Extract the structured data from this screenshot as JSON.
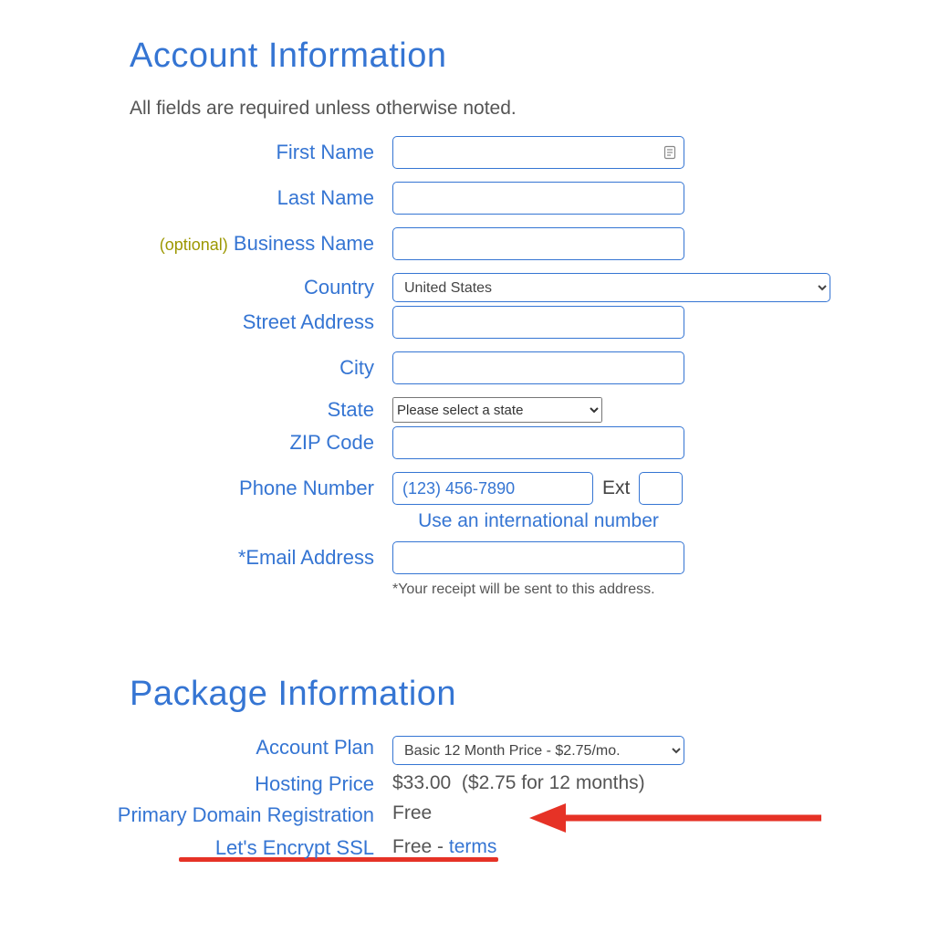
{
  "account": {
    "title": "Account Information",
    "instructions": "All fields are required unless otherwise noted.",
    "labels": {
      "first_name": "First Name",
      "last_name": "Last Name",
      "business_name": "Business Name",
      "business_optional": "(optional)",
      "country": "Country",
      "street_address": "Street Address",
      "city": "City",
      "state": "State",
      "zip": "ZIP Code",
      "phone": "Phone Number",
      "ext": "Ext",
      "intl_link": "Use an international number",
      "email": "*Email Address",
      "receipt_note": "*Your receipt will be sent to this address."
    },
    "values": {
      "first_name": "",
      "last_name": "",
      "business_name": "",
      "country": "United States",
      "street_address": "",
      "city": "",
      "state": "Please select a state",
      "zip": "",
      "phone": "",
      "phone_placeholder": "(123) 456-7890",
      "ext": "",
      "email": ""
    }
  },
  "package": {
    "title": "Package Information",
    "labels": {
      "account_plan": "Account Plan",
      "hosting_price": "Hosting Price",
      "primary_domain_registration": "Primary Domain Registration",
      "lets_encrypt_ssl": "Let's Encrypt SSL"
    },
    "values": {
      "account_plan": "Basic 12 Month Price - $2.75/mo.",
      "hosting_price_main": "$33.00",
      "hosting_price_detail": "($2.75 for 12 months)",
      "primary_domain_registration": "Free",
      "lets_encrypt_ssl_value": "Free",
      "lets_encrypt_ssl_dash": " - ",
      "lets_encrypt_ssl_terms": "terms"
    }
  }
}
